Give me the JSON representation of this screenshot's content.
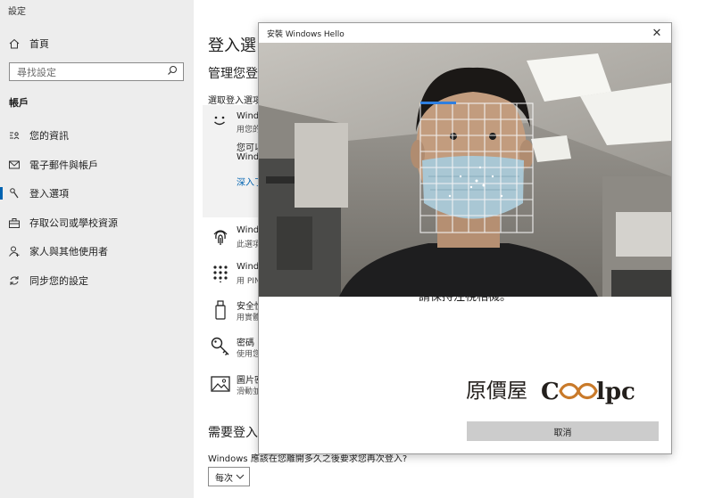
{
  "app": {
    "title": "設定"
  },
  "nav": {
    "home": "首頁",
    "search_placeholder": "尋找設定",
    "section": "帳戶",
    "items": [
      {
        "label": "您的資訊",
        "icon": "person-card-icon"
      },
      {
        "label": "電子郵件與帳戶",
        "icon": "mail-icon"
      },
      {
        "label": "登入選項",
        "icon": "key-icon",
        "selected": true
      },
      {
        "label": "存取公司或學校資源",
        "icon": "briefcase-icon"
      },
      {
        "label": "家人與其他使用者",
        "icon": "add-person-icon"
      },
      {
        "label": "同步您的設定",
        "icon": "sync-icon"
      }
    ]
  },
  "main": {
    "title": "登入選",
    "manage": "管理您登",
    "choose": "選取登入選項",
    "face": {
      "label": "Windo",
      "desc": "用您的",
      "line1": "您可以",
      "line2": "Windo",
      "link": "深入了"
    },
    "options": [
      {
        "label": "Windo",
        "desc": "此選項",
        "icon": "fingerprint-icon"
      },
      {
        "label": "Windo",
        "desc": "用 PIN",
        "icon": "pin-keypad-icon"
      },
      {
        "label": "安全性",
        "desc": "用實體",
        "icon": "usb-key-icon"
      },
      {
        "label": "密碼",
        "desc": "使用您",
        "icon": "key-icon"
      },
      {
        "label": "圖片密",
        "desc": "滑動並",
        "icon": "picture-icon"
      }
    ],
    "require_title": "需要登入",
    "question": "Windows 應該在您離開多久之後要求您再次登入?",
    "frequency": "每次"
  },
  "dialog": {
    "title": "安裝 Windows Hello",
    "close_glyph": "✕",
    "instruction": "請保持注視相機。",
    "watermark_text": "原價屋Coolpc",
    "cancel": "取消"
  },
  "colors": {
    "accent": "#0063b1",
    "nav_bg": "#ededed",
    "button_bg": "#cccccc"
  }
}
